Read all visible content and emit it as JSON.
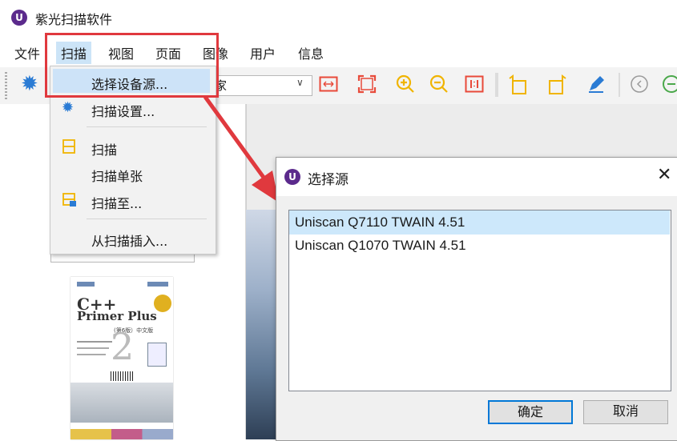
{
  "app": {
    "title": "紫光扫描软件",
    "logo_letter": "U"
  },
  "menubar": {
    "items": [
      "文件",
      "扫描",
      "视图",
      "页面",
      "图像",
      "用户",
      "信息"
    ],
    "active": "扫描"
  },
  "toolbar": {
    "combo_text": "家",
    "icons": [
      "settings-gear-icon",
      "fit-width-icon",
      "fit-page-icon",
      "zoom-in-icon",
      "zoom-out-icon",
      "actual-size-icon",
      "rotate-left-icon",
      "rotate-right-icon",
      "pen-edit-icon",
      "previous-icon",
      "next-icon"
    ]
  },
  "scan_menu": {
    "items": [
      {
        "label": "选择设备源...",
        "icon": "",
        "highlighted": true
      },
      {
        "label": "扫描设置...",
        "icon": "gear-icon"
      },
      {
        "label": "扫描",
        "icon": "scan-icon"
      },
      {
        "label": "扫描单张",
        "icon": ""
      },
      {
        "label": "扫描至...",
        "icon": "scan-to-icon"
      },
      {
        "label": "从扫描插入...",
        "icon": ""
      }
    ]
  },
  "thumbnail": {
    "book_title_line1": "C++",
    "book_title_line2": "Primer Plus",
    "book_edition": "(第6版）中文版",
    "book_number": "2"
  },
  "dialog": {
    "title": "选择源",
    "close_symbol": "✕",
    "sources": [
      "Uniscan Q7110 TWAIN 4.51",
      "Uniscan Q1070 TWAIN 4.51"
    ],
    "selected_index": 0,
    "ok_label": "确定",
    "cancel_label": "取消"
  },
  "colors": {
    "highlight_red": "#e0393e",
    "selection_blue": "#cde8fb",
    "brand_purple": "#5b2a8c",
    "icon_orange_red": "#e84a3a",
    "icon_yellow": "#f0b400",
    "icon_blue": "#2a7bd4"
  }
}
